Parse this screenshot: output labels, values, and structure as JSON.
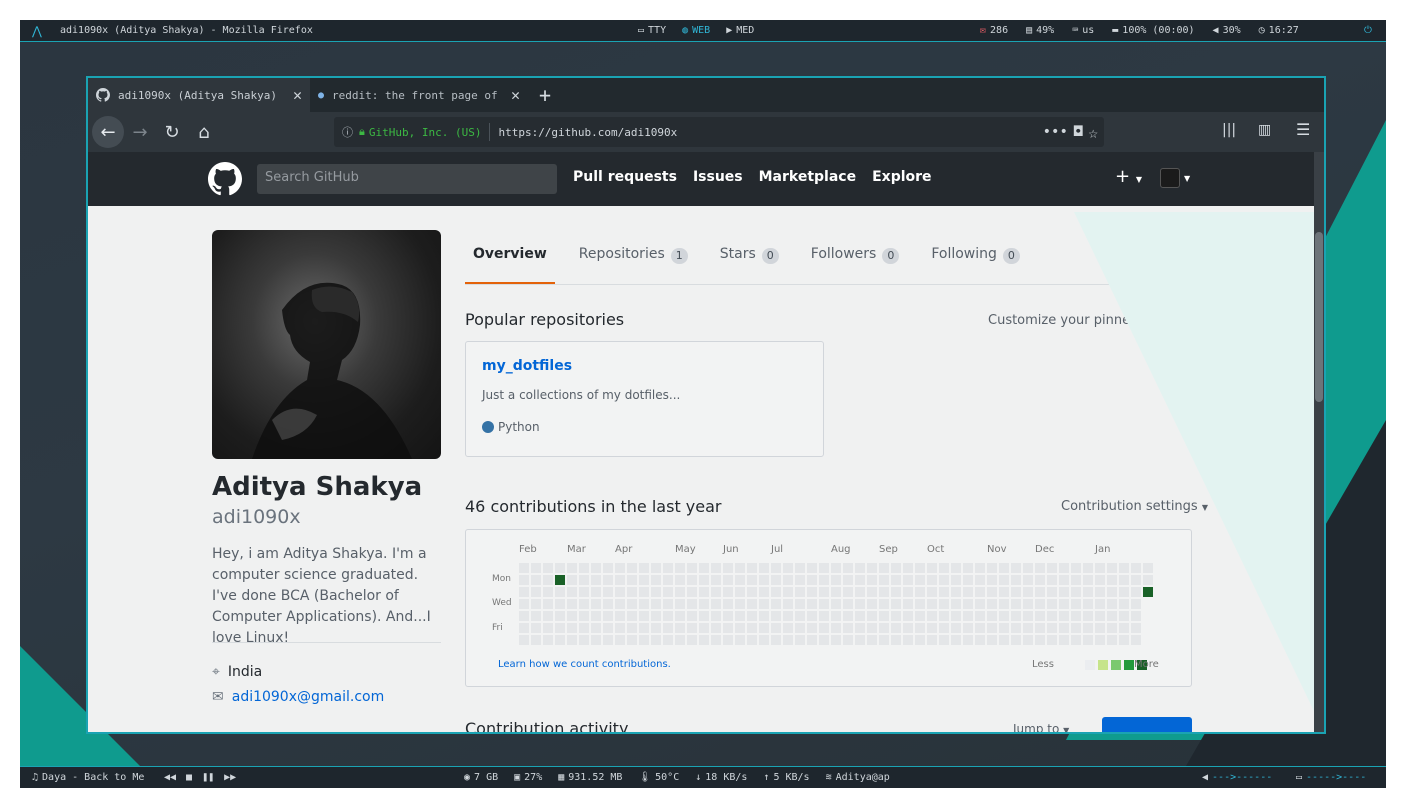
{
  "topbar": {
    "logo": "arch-logo-icon",
    "window_title": "adi1090x (Aditya Shakya) - Mozilla Firefox",
    "workspaces": [
      {
        "icon": "terminal-icon",
        "label": "TTY",
        "active": false
      },
      {
        "icon": "globe-icon",
        "label": "WEB",
        "active": true
      },
      {
        "icon": "media-icon",
        "label": "MED",
        "active": false
      }
    ],
    "status": [
      {
        "icon": "mail-icon",
        "label": "286"
      },
      {
        "icon": "disk-icon",
        "label": "49%"
      },
      {
        "icon": "keyboard-icon",
        "label": "us"
      },
      {
        "icon": "battery-icon",
        "label": "100% (00:00)"
      },
      {
        "icon": "volume-icon",
        "label": "30%"
      },
      {
        "icon": "clock-icon",
        "label": "16:27"
      }
    ],
    "power_icon": "power-icon"
  },
  "browser": {
    "tabs": [
      {
        "title": "adi1090x (Aditya Shakya)",
        "icon": "github-icon",
        "active": true
      },
      {
        "title": "reddit: the front page of",
        "icon": "reddit-icon",
        "active": false
      }
    ],
    "urlbar": {
      "identity": "GitHub, Inc. (US)",
      "url": "https://github.com/adi1090x"
    }
  },
  "github": {
    "search_placeholder": "Search GitHub",
    "nav": [
      "Pull requests",
      "Issues",
      "Marketplace",
      "Explore"
    ],
    "plus": "+",
    "profile": {
      "name": "Aditya Shakya",
      "login": "adi1090x",
      "bio": "Hey, i am Aditya Shakya. I'm a computer science graduated. I've done BCA (Bachelor of Computer Applications). And...I love Linux!",
      "location": "India",
      "email": "adi1090x@gmail.com"
    },
    "tabs": [
      {
        "label": "Overview",
        "count": null,
        "selected": true
      },
      {
        "label": "Repositories",
        "count": "1",
        "selected": false
      },
      {
        "label": "Stars",
        "count": "0",
        "selected": false
      },
      {
        "label": "Followers",
        "count": "0",
        "selected": false
      },
      {
        "label": "Following",
        "count": "0",
        "selected": false
      }
    ],
    "popular_title": "Popular repositories",
    "customize_link": "Customize your pinned repositories",
    "repo": {
      "name": "my_dotfiles",
      "description": "Just a collections of my dotfiles...",
      "language": "Python",
      "language_color": "#3572a5"
    },
    "contributions_title": "46 contributions in the last year",
    "contribution_settings": "Contribution settings",
    "months": [
      "Feb",
      "Mar",
      "Apr",
      "May",
      "Jun",
      "Jul",
      "Aug",
      "Sep",
      "Oct",
      "Nov",
      "Dec",
      "Jan"
    ],
    "day_labels": [
      "Mon",
      "Wed",
      "Fri"
    ],
    "learn_link": "Learn how we count contributions.",
    "legend_less": "Less",
    "legend_more": "More",
    "legend_colors": [
      "#ebedf0",
      "#c6e48b",
      "#7bc96f",
      "#239a3b",
      "#196127"
    ],
    "activity_title": "Contribution activity",
    "jump_to": "Jump to"
  },
  "bottombar": {
    "music": {
      "icon": "music-icon",
      "label": "Daya - Back to Me"
    },
    "controls": [
      "prev-icon",
      "stop-icon",
      "pause-icon",
      "next-icon"
    ],
    "stats": [
      {
        "icon": "ram-icon",
        "label": "7 GB"
      },
      {
        "icon": "cpu-icon",
        "label": "27%"
      },
      {
        "icon": "hdd-icon",
        "label": "931.52 MB"
      },
      {
        "icon": "temp-icon",
        "label": "50°C"
      },
      {
        "icon": "download-icon",
        "label": "18 KB/s"
      },
      {
        "icon": "upload-icon",
        "label": "5 KB/s"
      },
      {
        "icon": "wifi-icon",
        "label": "Aditya@ap"
      }
    ],
    "volume_bar": "--->------",
    "brightness_bar": "----->----"
  }
}
